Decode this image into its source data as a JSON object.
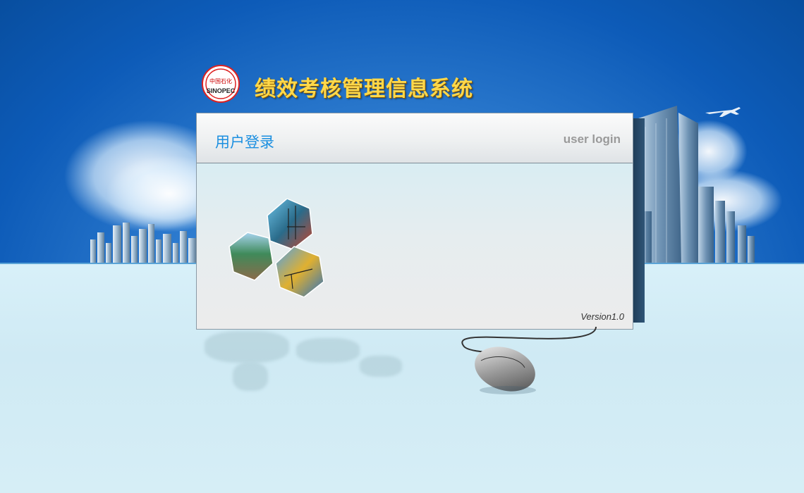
{
  "app": {
    "title": "绩效考核管理信息系统",
    "logo_icon": "sinopec-logo-icon",
    "logo_text": "SINOPEC",
    "logo_cn": "中国石化"
  },
  "login_panel": {
    "title": "用户登录",
    "subtitle": "user login",
    "version": "Version1.0",
    "illustration_icon": "oil-industry-hexagons-icon"
  },
  "colors": {
    "title_yellow": "#ffd84a",
    "panel_title_blue": "#1b8fe0",
    "sky_blue": "#0d5bb8"
  }
}
